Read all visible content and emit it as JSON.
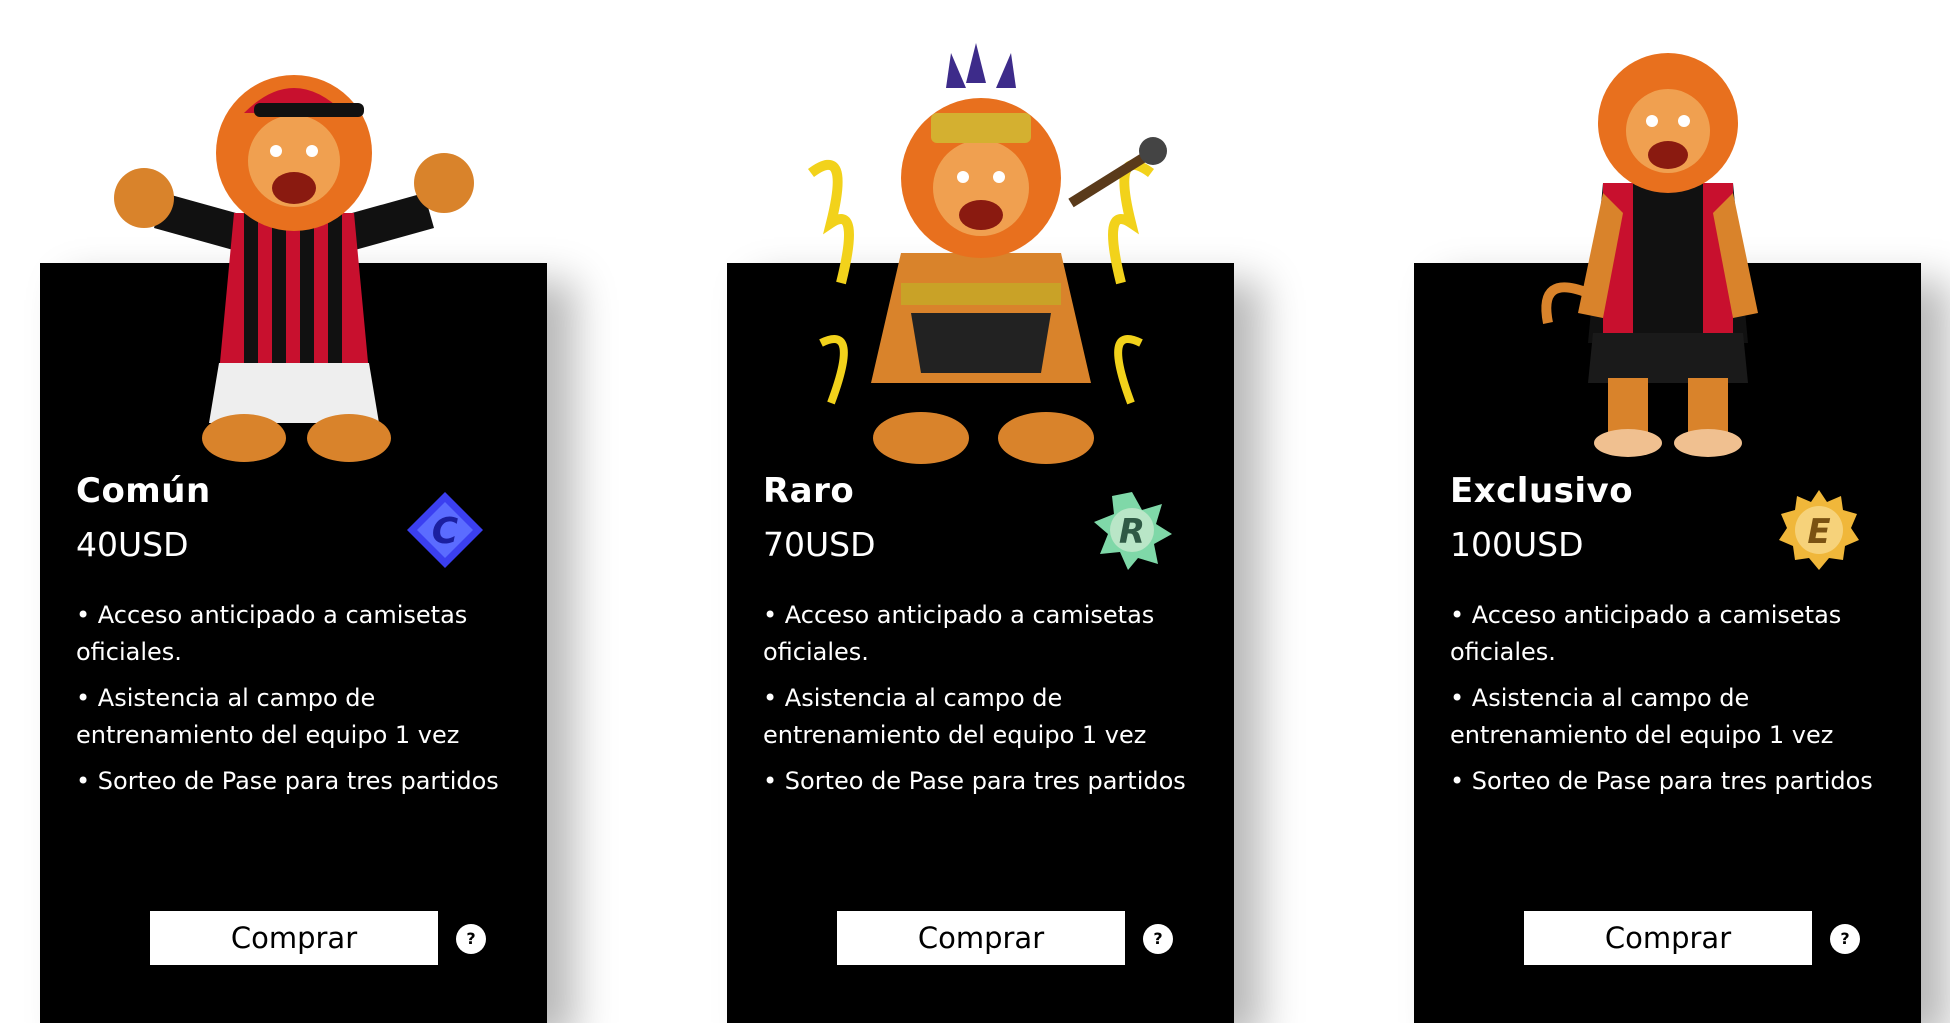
{
  "cards": [
    {
      "name": "Común",
      "price": "40USD",
      "badge_letter": "C",
      "benefits": [
        "Acceso anticipado a camisetas oficiales.",
        "Asistencia al campo de entrenamiento del equipo 1 vez",
        "Sorteo de Pase para tres partidos"
      ],
      "buy_label": "Comprar",
      "help_label": "?"
    },
    {
      "name": "Raro",
      "price": "70USD",
      "badge_letter": "R",
      "benefits": [
        "Acceso anticipado a camisetas oficiales.",
        "Asistencia al campo de entrenamiento del equipo 1 vez",
        "Sorteo de Pase para tres partidos"
      ],
      "buy_label": "Comprar",
      "help_label": "?"
    },
    {
      "name": "Exclusivo",
      "price": "100USD",
      "badge_letter": "E",
      "benefits": [
        "Acceso anticipado a camisetas oficiales.",
        "Asistencia al campo de entrenamiento del equipo 1 vez",
        "Sorteo de Pase para tres partidos"
      ],
      "buy_label": "Comprar",
      "help_label": "?"
    }
  ],
  "colors": {
    "card_bg": "#000000",
    "text": "#ffffff",
    "button_bg": "#ffffff",
    "button_text": "#000000",
    "badge_comun": "#3b3ff0",
    "badge_raro": "#7fd8a8",
    "badge_exclusivo": "#f0b73a",
    "mane": "#e8701e",
    "jersey_red": "#c8102e",
    "jersey_black": "#111111"
  },
  "icons": {
    "mascot": "lion-mascot-icon",
    "badge_comun": "rarity-badge-c-icon",
    "badge_raro": "rarity-badge-r-icon",
    "badge_exclusivo": "rarity-badge-e-icon",
    "help": "question-icon"
  }
}
